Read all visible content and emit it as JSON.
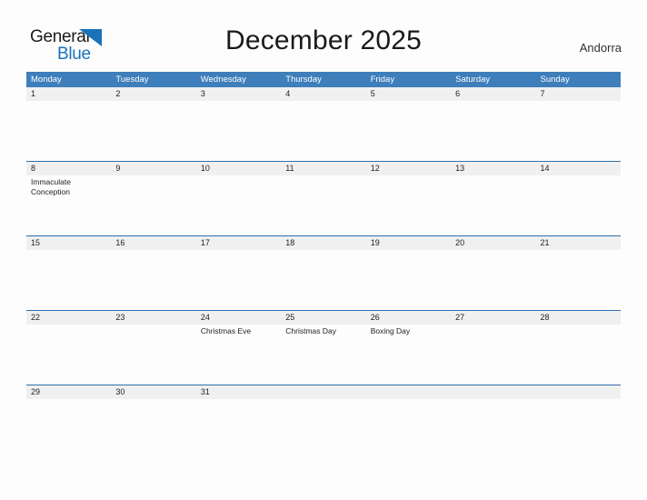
{
  "brand": {
    "name_part1": "General",
    "name_part2": "Blue",
    "triangle_color": "#1b72b8"
  },
  "header": {
    "title": "December 2025",
    "country": "Andorra"
  },
  "theme": {
    "header_blue": "#3d7ebb",
    "separator_blue": "#2f6fae",
    "date_band_gray": "#f0f0f0",
    "page_background": "#fdfdfd"
  },
  "calendar": {
    "weekdays": [
      "Monday",
      "Tuesday",
      "Wednesday",
      "Thursday",
      "Friday",
      "Saturday",
      "Sunday"
    ],
    "weeks": [
      {
        "days": [
          {
            "date": "1",
            "event": ""
          },
          {
            "date": "2",
            "event": ""
          },
          {
            "date": "3",
            "event": ""
          },
          {
            "date": "4",
            "event": ""
          },
          {
            "date": "5",
            "event": ""
          },
          {
            "date": "6",
            "event": ""
          },
          {
            "date": "7",
            "event": ""
          }
        ]
      },
      {
        "days": [
          {
            "date": "8",
            "event": "Immaculate Conception"
          },
          {
            "date": "9",
            "event": ""
          },
          {
            "date": "10",
            "event": ""
          },
          {
            "date": "11",
            "event": ""
          },
          {
            "date": "12",
            "event": ""
          },
          {
            "date": "13",
            "event": ""
          },
          {
            "date": "14",
            "event": ""
          }
        ]
      },
      {
        "days": [
          {
            "date": "15",
            "event": ""
          },
          {
            "date": "16",
            "event": ""
          },
          {
            "date": "17",
            "event": ""
          },
          {
            "date": "18",
            "event": ""
          },
          {
            "date": "19",
            "event": ""
          },
          {
            "date": "20",
            "event": ""
          },
          {
            "date": "21",
            "event": ""
          }
        ]
      },
      {
        "days": [
          {
            "date": "22",
            "event": ""
          },
          {
            "date": "23",
            "event": ""
          },
          {
            "date": "24",
            "event": "Christmas Eve"
          },
          {
            "date": "25",
            "event": "Christmas Day"
          },
          {
            "date": "26",
            "event": "Boxing Day"
          },
          {
            "date": "27",
            "event": ""
          },
          {
            "date": "28",
            "event": ""
          }
        ]
      },
      {
        "days": [
          {
            "date": "29",
            "event": ""
          },
          {
            "date": "30",
            "event": ""
          },
          {
            "date": "31",
            "event": ""
          },
          {
            "date": "",
            "event": ""
          },
          {
            "date": "",
            "event": ""
          },
          {
            "date": "",
            "event": ""
          },
          {
            "date": "",
            "event": ""
          }
        ]
      }
    ]
  }
}
